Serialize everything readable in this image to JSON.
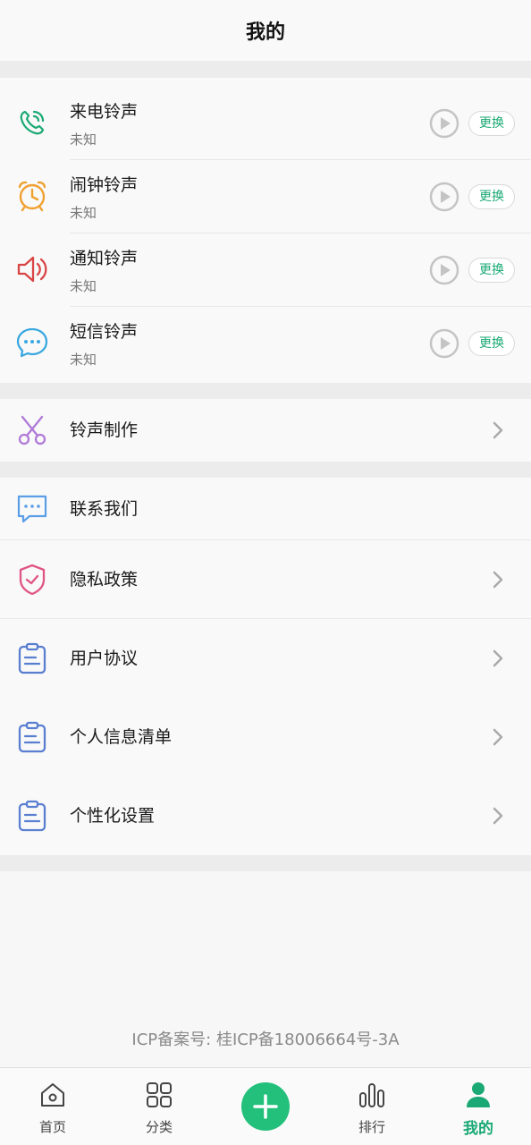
{
  "header": {
    "title": "我的"
  },
  "ringtones": [
    {
      "title": "来电铃声",
      "subtitle": "未知",
      "change_label": "更换",
      "icon": "phone-icon",
      "color": "#1aa974"
    },
    {
      "title": "闹钟铃声",
      "subtitle": "未知",
      "change_label": "更换",
      "icon": "alarm-clock-icon",
      "color": "#f0a030"
    },
    {
      "title": "通知铃声",
      "subtitle": "未知",
      "change_label": "更换",
      "icon": "speaker-icon",
      "color": "#d94545"
    },
    {
      "title": "短信铃声",
      "subtitle": "未知",
      "change_label": "更换",
      "icon": "message-bubble-icon",
      "color": "#3ba8e0"
    }
  ],
  "maker": {
    "title": "铃声制作",
    "icon": "scissors-icon",
    "color": "#b07ad8"
  },
  "menu": [
    {
      "title": "联系我们",
      "icon": "chat-icon",
      "color": "#5b9ee6",
      "chevron": false
    },
    {
      "title": "隐私政策",
      "icon": "shield-check-icon",
      "color": "#e05585",
      "chevron": true
    },
    {
      "title": "用户协议",
      "icon": "clipboard-icon",
      "color": "#5a7fd0",
      "chevron": true
    },
    {
      "title": "个人信息清单",
      "icon": "clipboard-icon",
      "color": "#5a7fd0",
      "chevron": true
    },
    {
      "title": "个性化设置",
      "icon": "clipboard-icon",
      "color": "#5a7fd0",
      "chevron": true
    }
  ],
  "footer": {
    "icp": "ICP备案号: 桂ICP备18006664号-3A"
  },
  "tabbar": {
    "items": [
      {
        "label": "首页",
        "icon": "home-icon"
      },
      {
        "label": "分类",
        "icon": "grid-icon"
      },
      {
        "label": "",
        "icon": "plus-icon"
      },
      {
        "label": "排行",
        "icon": "bar-chart-icon"
      },
      {
        "label": "我的",
        "icon": "person-icon",
        "active": true
      }
    ],
    "accent": "#1aa974"
  }
}
